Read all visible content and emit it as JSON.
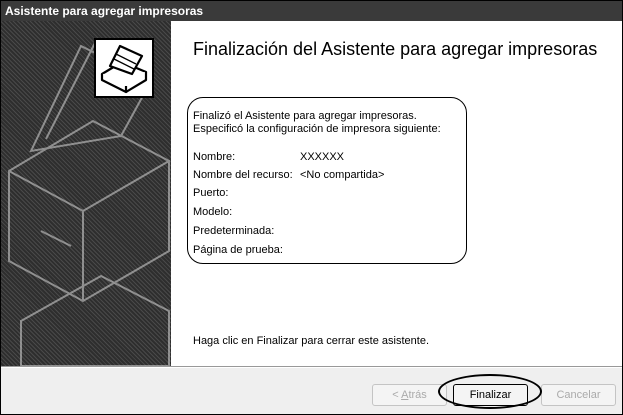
{
  "window": {
    "title": "Asistente para agregar impresoras"
  },
  "heading": "Finalización del Asistente para agregar impresoras",
  "intro": {
    "line1": "Finalizó el Asistente para agregar impresoras.",
    "line2": "Especificó la configuración de impresora siguiente:"
  },
  "settings": [
    {
      "label": "Nombre:",
      "value": "XXXXXX"
    },
    {
      "label": "Nombre del recurso:",
      "value": "<No compartida>"
    },
    {
      "label": "Puerto:",
      "value": ""
    },
    {
      "label": "Modelo:",
      "value": ""
    },
    {
      "label": "Predeterminada:",
      "value": ""
    },
    {
      "label": "Página de prueba:",
      "value": ""
    }
  ],
  "footer_instruction": "Haga clic en Finalizar para cerrar este asistente.",
  "buttons": {
    "back_prefix": "< ",
    "back_key": "A",
    "back_rest": "trás",
    "finish": "Finalizar",
    "cancel": "Cancelar"
  },
  "icons": {
    "banner": "printer-wizard-icon"
  }
}
